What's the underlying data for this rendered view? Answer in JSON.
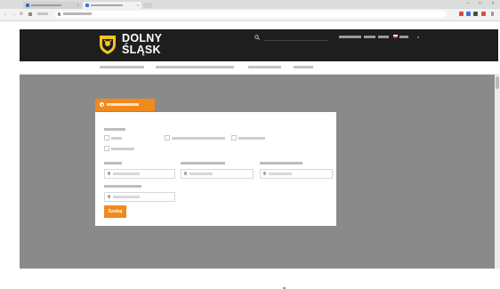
{
  "browser": {
    "tabs": [
      {
        "label": "",
        "favicon_color": "#2b6fbf"
      },
      {
        "label": "",
        "favicon_color": "#3a78d0",
        "active": true
      }
    ],
    "url": "",
    "window_controls": [
      "–",
      "□",
      "×"
    ],
    "nav_glyphs": {
      "back": "←",
      "forward": "→",
      "reload": "⟳"
    },
    "extension_colors": [
      "#e04a3a",
      "#3a78d0",
      "#4a4a4a",
      "#e04a3a"
    ]
  },
  "site": {
    "logo_line1": "DOLNY",
    "logo_line2": "ŚLĄSK",
    "brand_color": "#f08a1c",
    "header_color": "#1e1e1e",
    "search_placeholder": "",
    "top_links": [
      "",
      "",
      ""
    ],
    "language": ""
  },
  "main_nav": {
    "items": [
      "",
      "",
      "",
      ""
    ]
  },
  "search_panel": {
    "tab_label": "",
    "object_type_label": "",
    "checkboxes": [
      "",
      "",
      "",
      ""
    ],
    "location_label": "",
    "location_placeholder": "",
    "date_from_label": "",
    "date_from_placeholder": "",
    "date_to_label": "",
    "date_to_placeholder": "",
    "keyword_label": "",
    "keyword_placeholder": "",
    "submit_label": "Szukaj"
  }
}
